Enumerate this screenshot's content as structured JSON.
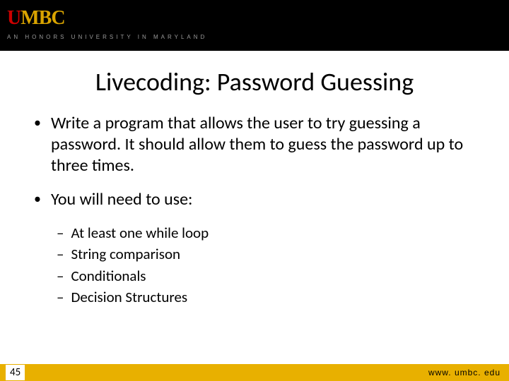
{
  "header": {
    "logo_part1": "UMBC",
    "tagline": "AN HONORS UNIVERSITY IN MARYLAND"
  },
  "title": "Livecoding: Password Guessing",
  "bullets": {
    "b1": "Write a program that allows the user to try guessing a password.  It should allow them to guess the password up to three times.",
    "b2": "You will need to use:",
    "sub": {
      "s1": "At least one while loop",
      "s2": "String comparison",
      "s3": "Conditionals",
      "s4": "Decision Structures"
    }
  },
  "footer": {
    "page": "45",
    "url": "www. umbc. edu"
  }
}
